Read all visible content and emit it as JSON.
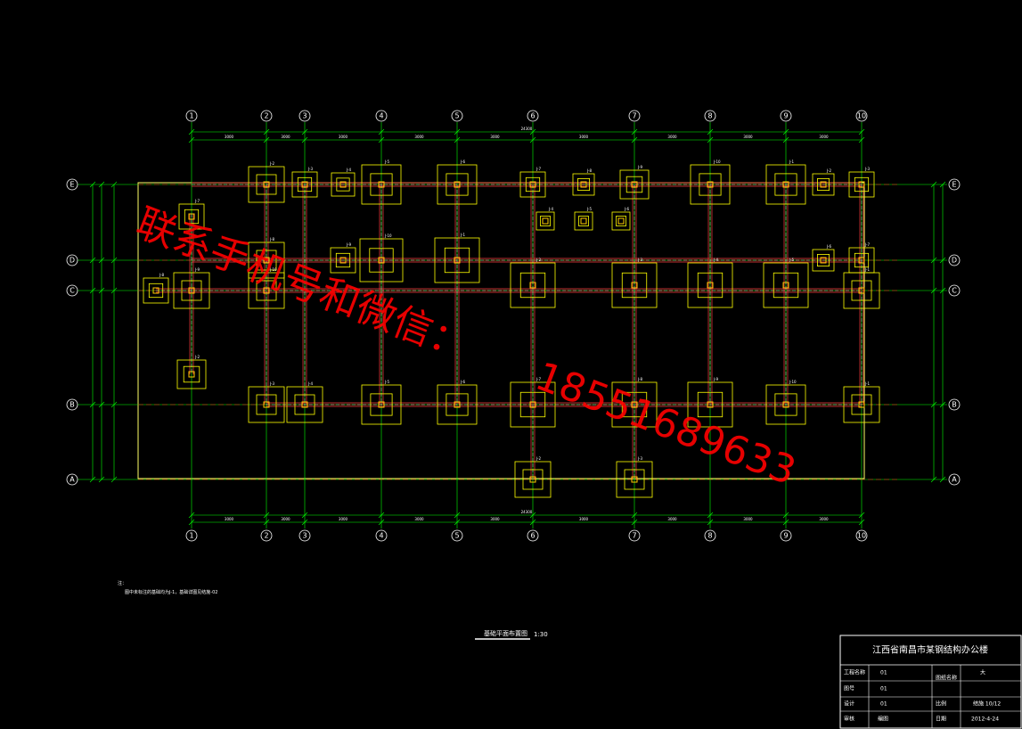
{
  "grid_x_labels": [
    "1",
    "2",
    "3",
    "4",
    "5",
    "6",
    "7",
    "8",
    "9",
    "10"
  ],
  "grid_y_labels": [
    "E",
    "D",
    "C",
    "B",
    "A"
  ],
  "footing_tags": [
    "J-2",
    "J-3",
    "J-4",
    "J-5",
    "J-6",
    "J-7",
    "J-8",
    "J-9",
    "J-10",
    "J-1"
  ],
  "dim_labels": {
    "total": "24300",
    "segment": "3000"
  },
  "notes": {
    "heading": "注：",
    "line1": "图中未标注的基础均为J-1，基础详图见结施-02"
  },
  "plan_title": {
    "name": "基础平面布置图",
    "scale": "1:30"
  },
  "title_block": {
    "project": "江西省南昌市某钢结构办公楼",
    "r1_label": "工程名称",
    "r1_value": "01",
    "r1_label2": "图纸名称",
    "r1_value2": "大",
    "r2_label": "图号",
    "r2_value": "01",
    "r3_label": "设计",
    "r3_value": "01",
    "r3_label2": "比例",
    "r3_value2": "结施 10/12",
    "r4_label": "审核",
    "r4_value": "编图",
    "r4_label2": "日期",
    "r4_value2": "2012-4-24"
  },
  "watermark": {
    "line1": "联系手机号和微信：",
    "line2": "18551689633"
  },
  "colors": {
    "grid": "#00ff00",
    "footing": "#ffff00",
    "beam": "#ff4040",
    "axis_circle": "#ffffff",
    "watermark": "#ff0000"
  }
}
